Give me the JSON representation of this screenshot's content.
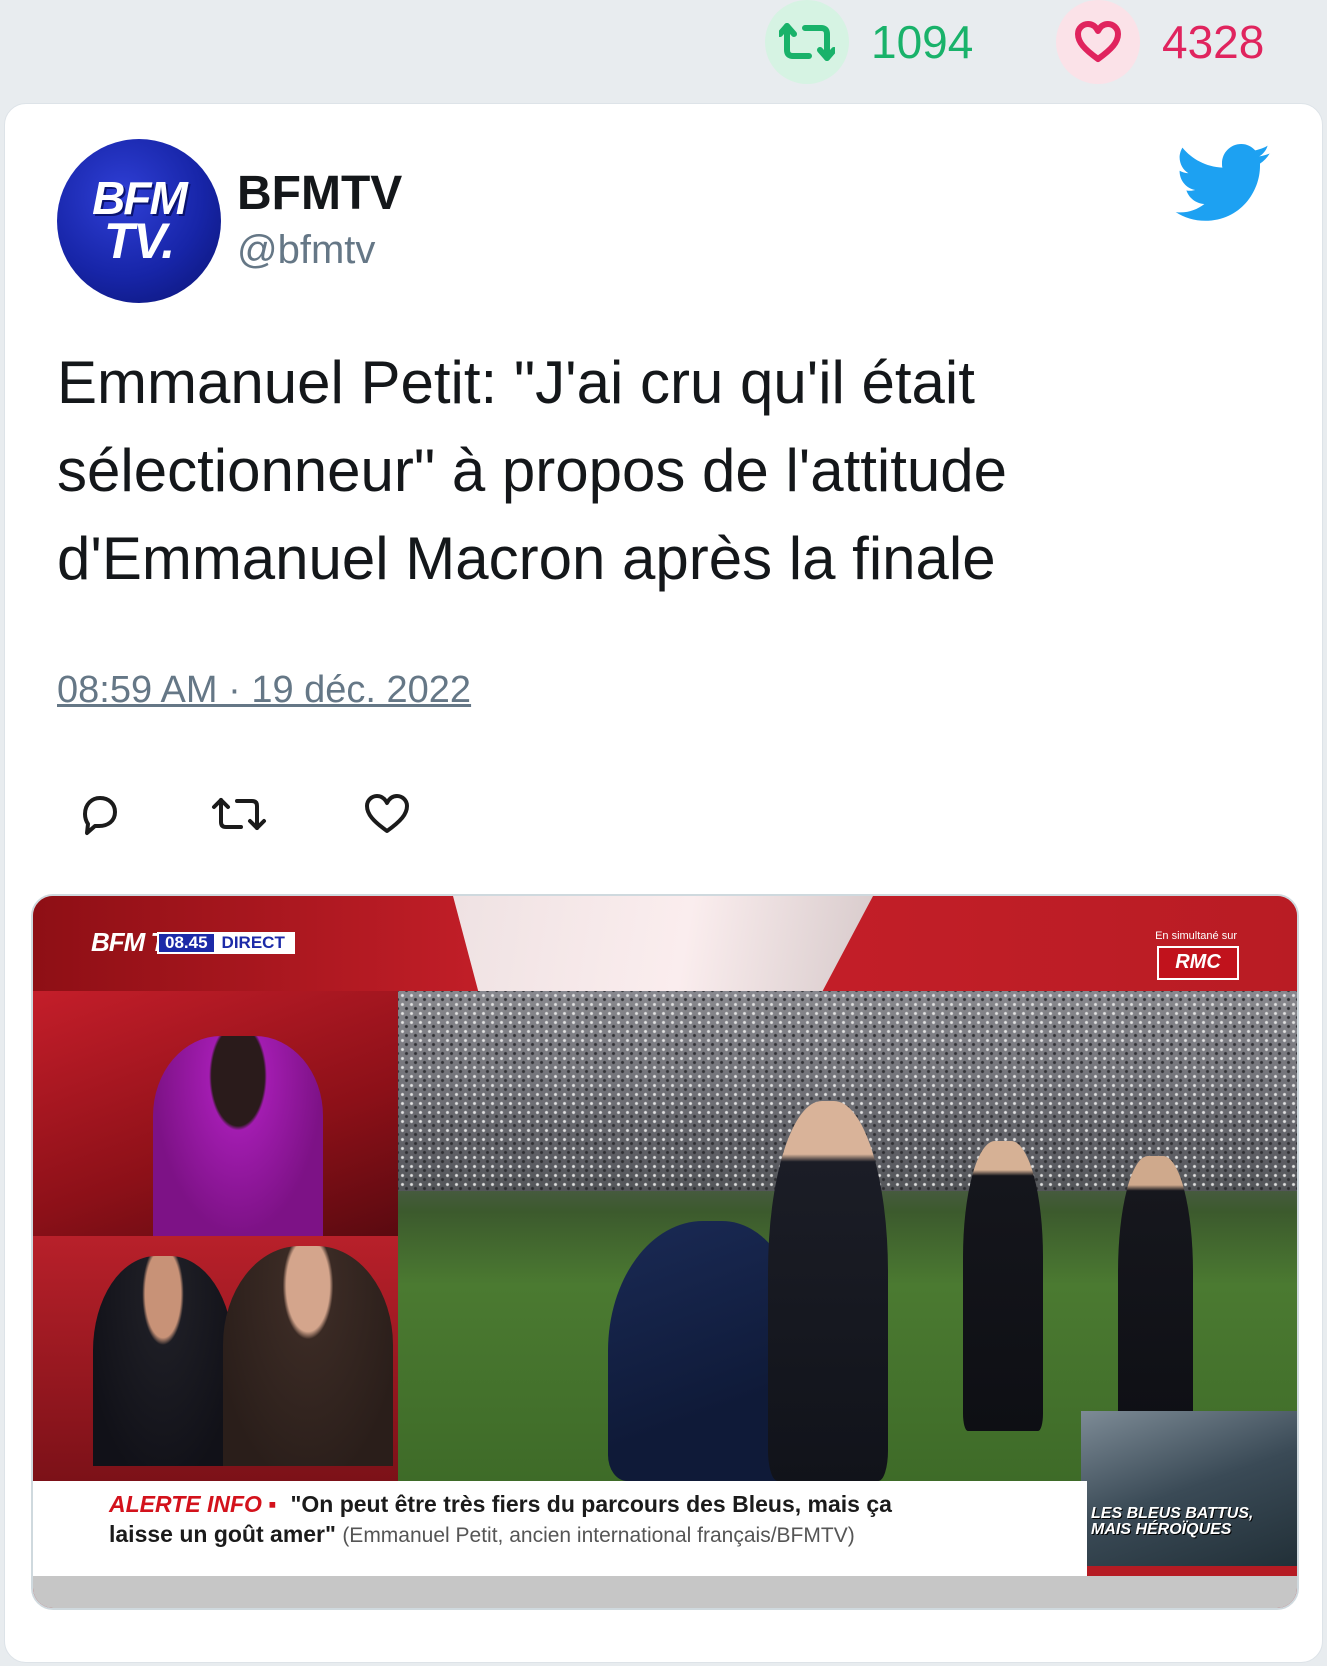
{
  "stats": {
    "retweets": "1094",
    "likes": "4328",
    "retweet_color": "#19b26a",
    "like_color": "#e0245e"
  },
  "tweet": {
    "avatar_line1": "BFM",
    "avatar_line2": "TV.",
    "name": "BFMTV",
    "handle": "@bfmtv",
    "text": "Emmanuel Petit: \"J'ai cru qu'il était sélectionneur\" à propos de l'attitude d'Emmanuel Macron après la finale",
    "timestamp": "08:59 AM · 19 déc. 2022"
  },
  "actions": [
    "reply-icon",
    "retweet-icon",
    "like-icon"
  ],
  "media": {
    "channel_logo": "BFM TV.",
    "time": "08.45",
    "live_label": "DIRECT",
    "simulcast_label": "En simultané sur",
    "simulcast_channel": "RMC",
    "alert_label": "ALERTE INFO ▪",
    "quote_line1": "\"On peut être très fiers du parcours des Bleus, mais ça",
    "quote_line2": "laisse un goût amer\"",
    "source": "(Emmanuel Petit, ancien international français/BFMTV)",
    "inset_text": "LES BLEUS BATTUS, MAIS HÉROÏQUES"
  }
}
